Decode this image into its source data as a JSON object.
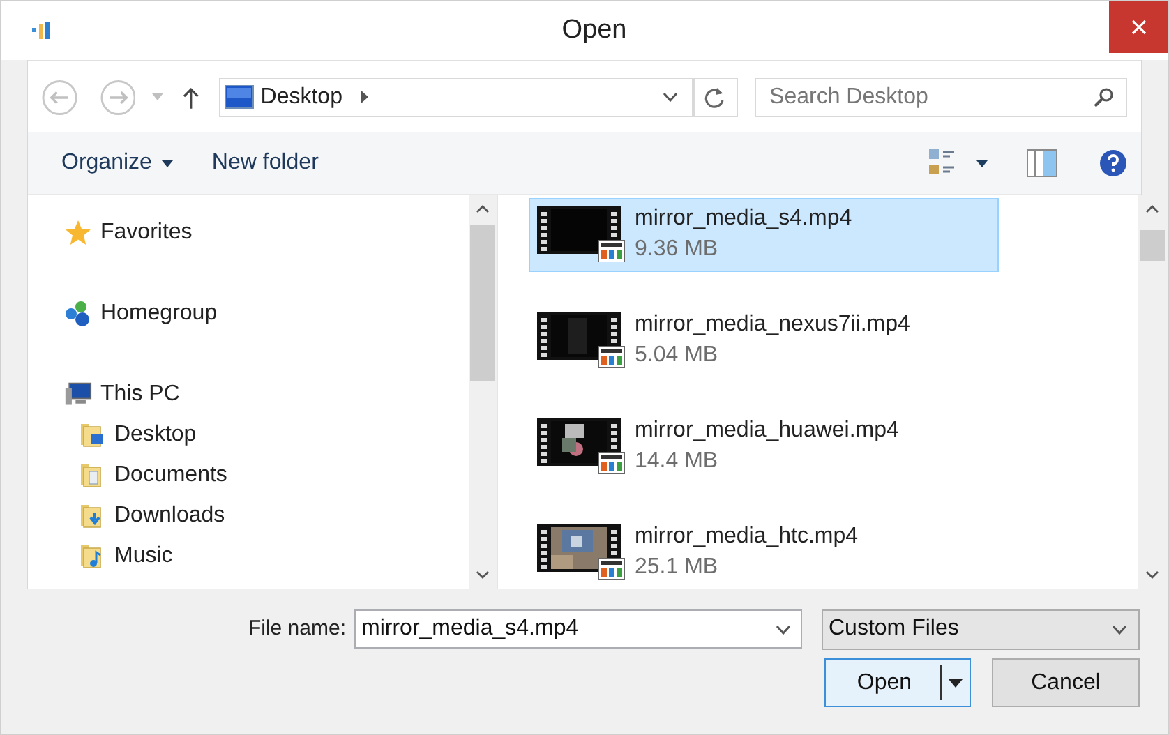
{
  "window": {
    "title": "Open"
  },
  "nav": {
    "address": "Desktop",
    "search_placeholder": "Search Desktop"
  },
  "toolbar": {
    "buttons": [
      {
        "label": "Organize",
        "dropdown": true
      },
      {
        "label": "New folder",
        "dropdown": false
      }
    ]
  },
  "sidebar": {
    "items": [
      {
        "label": "Favorites",
        "kind": "star"
      },
      {
        "label": "Homegroup",
        "kind": "homegroup"
      },
      {
        "label": "This PC",
        "kind": "pc",
        "children": [
          {
            "label": "Desktop",
            "kind": "desktop"
          },
          {
            "label": "Documents",
            "kind": "documents"
          },
          {
            "label": "Downloads",
            "kind": "downloads"
          },
          {
            "label": "Music",
            "kind": "music"
          }
        ]
      }
    ]
  },
  "files": [
    {
      "name": "mirror_media_s4.mp4",
      "size": "9.36 MB",
      "selected": true
    },
    {
      "name": "mirror_media_nexus7ii.mp4",
      "size": "5.04 MB",
      "selected": false
    },
    {
      "name": "mirror_media_huawei.mp4",
      "size": "14.4 MB",
      "selected": false
    },
    {
      "name": "mirror_media_htc.mp4",
      "size": "25.1 MB",
      "selected": false
    }
  ],
  "file_name": {
    "label": "File name:",
    "value": "mirror_media_s4.mp4"
  },
  "file_type": {
    "value": "Custom Files"
  },
  "buttons": [
    {
      "label": "Open",
      "kind": "split"
    },
    {
      "label": "Cancel",
      "kind": "plain"
    }
  ]
}
